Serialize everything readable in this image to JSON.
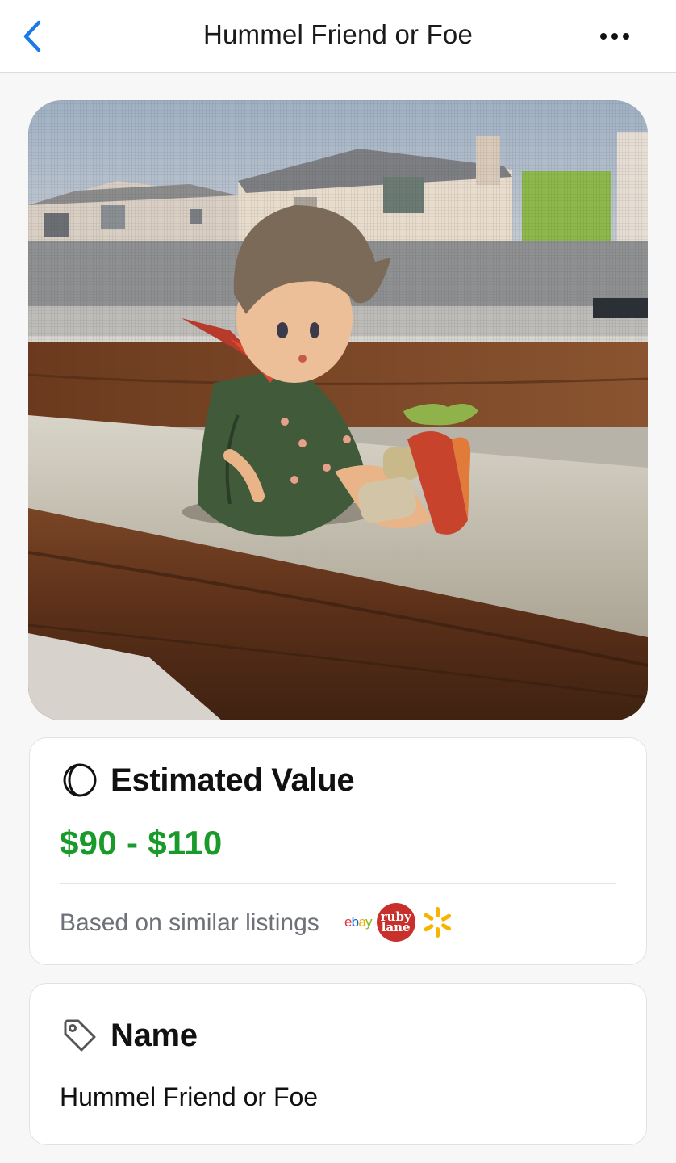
{
  "header": {
    "title": "Hummel Friend or Foe",
    "back_icon": "chevron-left-icon",
    "more_icon": "ellipsis-icon",
    "accent_color": "#1a7ae8"
  },
  "estimated_value": {
    "icon": "moon-icon",
    "title": "Estimated Value",
    "price": "$90 - $110",
    "price_color": "#1a9a2a",
    "basis": "Based on similar listings",
    "sources": {
      "ebay": "ebay",
      "ruby_line1": "ruby",
      "ruby_line2": "lane",
      "walmart_icon": "walmart-spark-icon"
    }
  },
  "name_card": {
    "icon": "tag-icon",
    "title": "Name",
    "value": "Hummel Friend or Foe"
  }
}
